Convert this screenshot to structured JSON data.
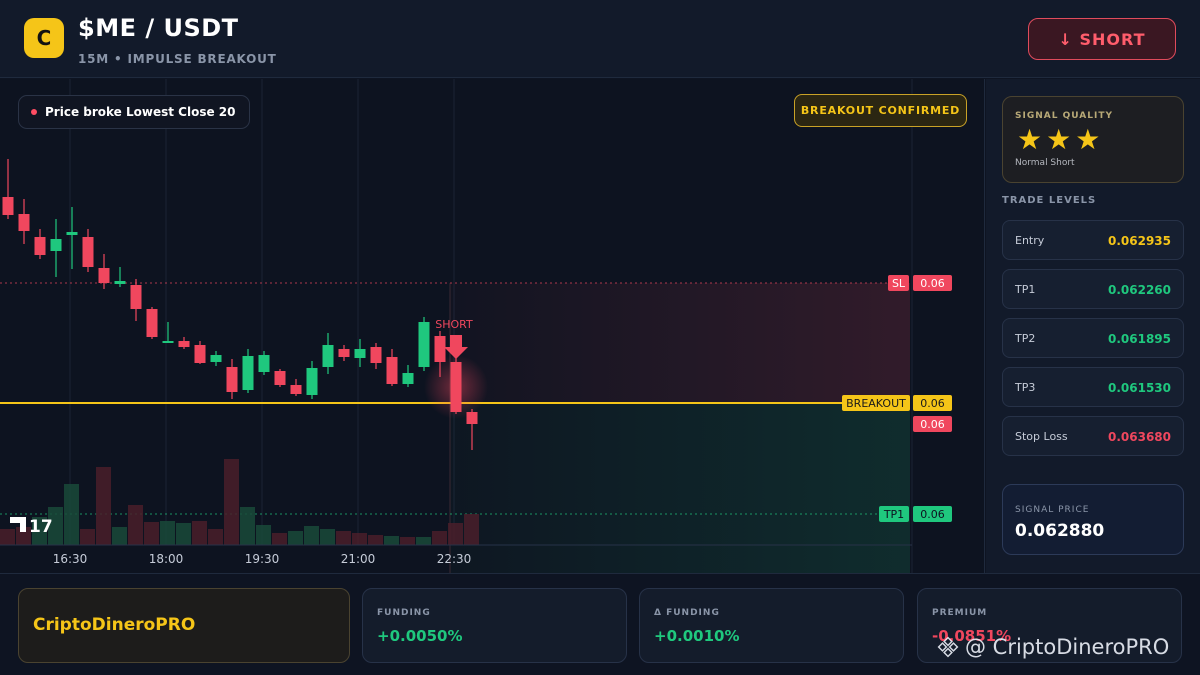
{
  "header": {
    "logo_letter": "C",
    "title": "$ME / USDT",
    "subtitle": "15M • IMPULSE BREAKOUT",
    "action_label": "↓ SHORT"
  },
  "chart": {
    "note": "Price broke Lowest Close 20",
    "badge": "BREAKOUT CONFIRMED",
    "short_label": "SHORT",
    "logo_text": "17",
    "time_labels": [
      "16:30",
      "18:00",
      "19:30",
      "21:00",
      "22:30"
    ],
    "line_tags": {
      "sl": "SL",
      "sl_value": "0.06",
      "breakout": "BREAKOUT",
      "breakout_value": "0.06",
      "price_value": "0.06",
      "tp1": "TP1",
      "tp1_value": "0.06"
    },
    "colors": {
      "up": "#1fc87e",
      "down": "#f0475e",
      "breakout": "#f5c518"
    }
  },
  "chart_data": {
    "type": "candlestick",
    "x": [
      "16:30",
      "18:00",
      "19:30",
      "21:00",
      "22:30"
    ],
    "levels": {
      "entry": 0.062935,
      "tp1": 0.06226,
      "stop_loss": 0.06368,
      "breakout": 0.06
    }
  },
  "sidebar": {
    "quality_label": "SIGNAL QUALITY",
    "stars": "★★★",
    "quality_sub": "Normal Short",
    "levels_title": "TRADE LEVELS",
    "levels": [
      {
        "label": "Entry",
        "value": "0.062935",
        "color": "#f5c518"
      },
      {
        "label": "TP1",
        "value": "0.062260",
        "color": "#1fc87e"
      },
      {
        "label": "TP2",
        "value": "0.061895",
        "color": "#1fc87e"
      },
      {
        "label": "TP3",
        "value": "0.061530",
        "color": "#1fc87e"
      },
      {
        "label": "Stop Loss",
        "value": "0.063680",
        "color": "#f0475e"
      }
    ],
    "signal_price_label": "SIGNAL PRICE",
    "signal_price": "0.062880"
  },
  "footer": {
    "brand": "CriptoDineroPRO",
    "metrics": [
      {
        "label": "FUNDING",
        "value": "+0.0050%",
        "color": "#1fc87e"
      },
      {
        "label": "Δ FUNDING",
        "value": "+0.0010%",
        "color": "#1fc87e"
      },
      {
        "label": "PREMIUM",
        "value": "-0.0851%",
        "color": "#f0475e"
      }
    ],
    "watermark": "@ CriptoDineroPRO"
  }
}
